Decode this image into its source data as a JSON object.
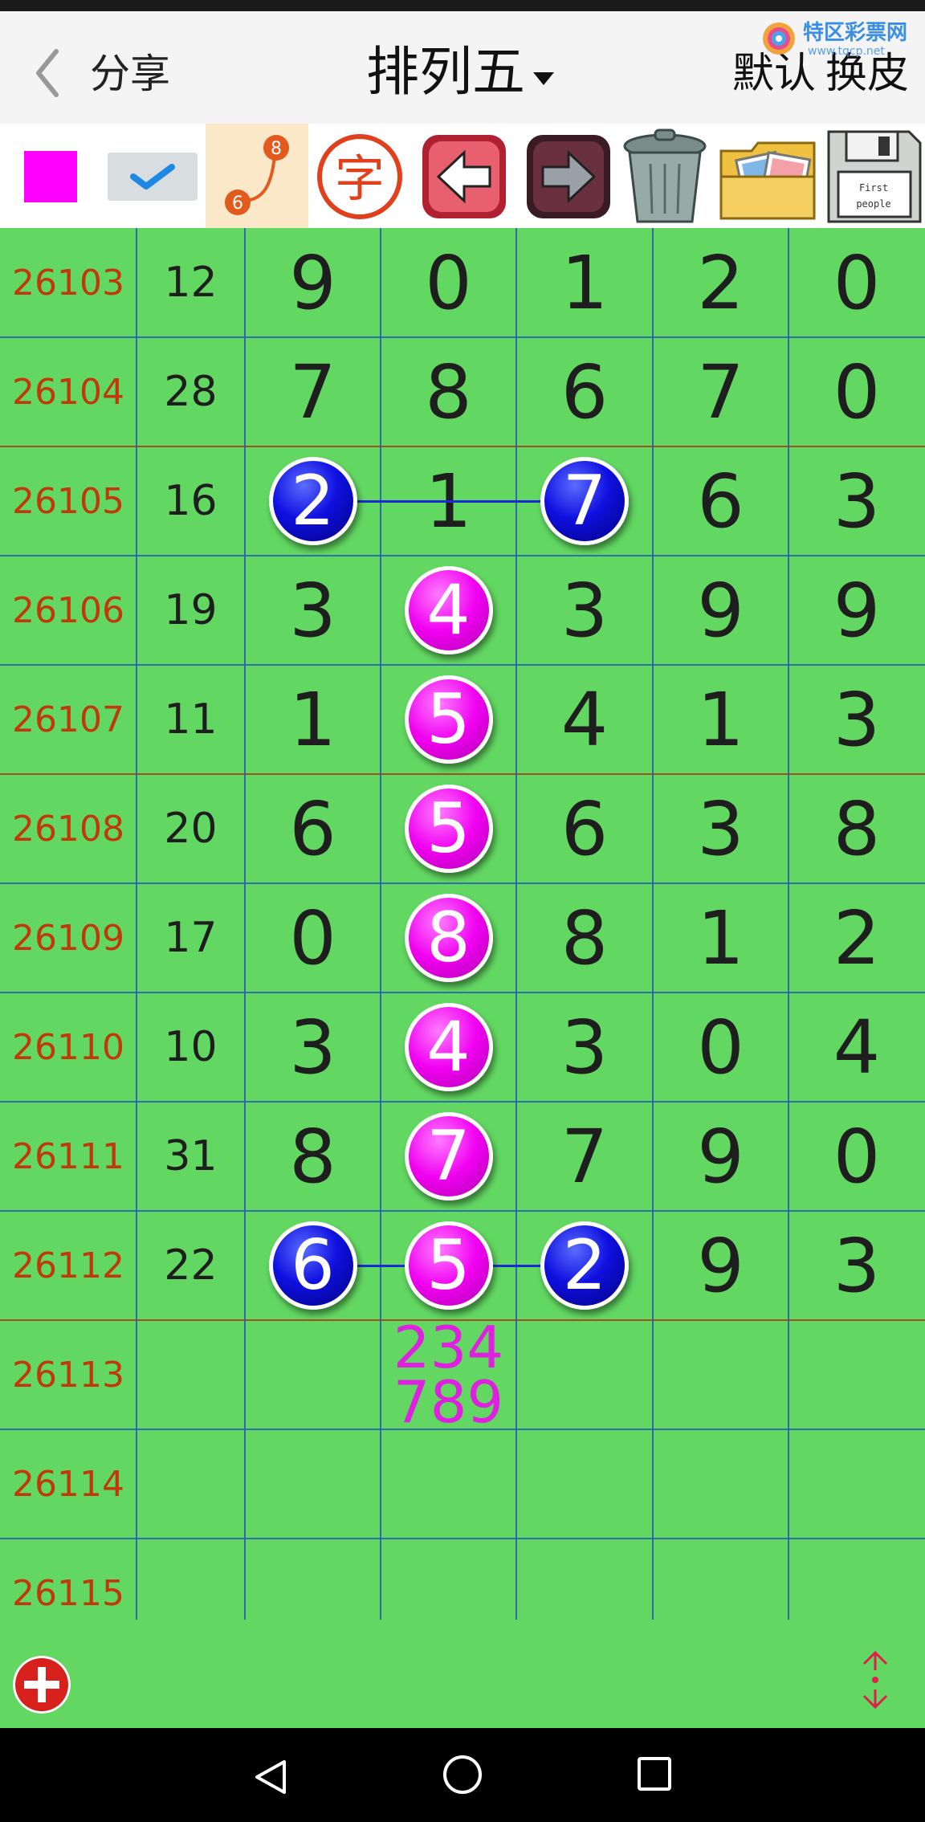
{
  "header": {
    "back_label": "‹",
    "share_label": "分享",
    "title": "排列五",
    "default_label": "默认",
    "skin_label": "换皮",
    "logo_text": "特区彩票网",
    "logo_url": "www.tqcp.net"
  },
  "toolbar": {
    "items": [
      {
        "name": "color-swatch",
        "color": "#ff00ff"
      },
      {
        "name": "check-toggle"
      },
      {
        "name": "line-connect-tool",
        "labels": [
          "8",
          "6"
        ]
      },
      {
        "name": "font-tool",
        "label": "字"
      },
      {
        "name": "undo-arrow"
      },
      {
        "name": "redo-arrow"
      },
      {
        "name": "trash"
      },
      {
        "name": "image-folder"
      },
      {
        "name": "save-disk",
        "labels": [
          "First",
          "people"
        ]
      }
    ]
  },
  "rows": [
    {
      "issue": "26103",
      "sum": "12",
      "digits": [
        "9",
        "0",
        "1",
        "2",
        "0"
      ]
    },
    {
      "issue": "26104",
      "sum": "28",
      "digits": [
        "7",
        "8",
        "6",
        "7",
        "0"
      ]
    },
    {
      "issue": "26105",
      "sum": "16",
      "digits": [
        "2",
        "1",
        "7",
        "6",
        "3"
      ]
    },
    {
      "issue": "26106",
      "sum": "19",
      "digits": [
        "3",
        "4",
        "3",
        "9",
        "9"
      ]
    },
    {
      "issue": "26107",
      "sum": "11",
      "digits": [
        "1",
        "5",
        "4",
        "1",
        "3"
      ]
    },
    {
      "issue": "26108",
      "sum": "20",
      "digits": [
        "6",
        "5",
        "6",
        "3",
        "8"
      ]
    },
    {
      "issue": "26109",
      "sum": "17",
      "digits": [
        "0",
        "8",
        "8",
        "1",
        "2"
      ]
    },
    {
      "issue": "26110",
      "sum": "10",
      "digits": [
        "3",
        "4",
        "3",
        "0",
        "4"
      ]
    },
    {
      "issue": "26111",
      "sum": "31",
      "digits": [
        "8",
        "7",
        "7",
        "9",
        "0"
      ]
    },
    {
      "issue": "26112",
      "sum": "22",
      "digits": [
        "6",
        "5",
        "2",
        "9",
        "3"
      ]
    },
    {
      "issue": "26113",
      "sum": "",
      "digits": [
        "",
        "",
        "",
        "",
        ""
      ]
    },
    {
      "issue": "26114",
      "sum": "",
      "digits": [
        "",
        "",
        "",
        "",
        ""
      ]
    },
    {
      "issue": "26115",
      "sum": "",
      "digits": [
        "",
        "",
        "",
        "",
        ""
      ]
    }
  ],
  "highlights": [
    {
      "row": 2,
      "col": 0,
      "style": "blue"
    },
    {
      "row": 2,
      "col": 2,
      "style": "blue"
    },
    {
      "row": 3,
      "col": 1,
      "style": "magenta"
    },
    {
      "row": 4,
      "col": 1,
      "style": "magenta"
    },
    {
      "row": 5,
      "col": 1,
      "style": "magenta"
    },
    {
      "row": 6,
      "col": 1,
      "style": "magenta"
    },
    {
      "row": 7,
      "col": 1,
      "style": "magenta"
    },
    {
      "row": 8,
      "col": 1,
      "style": "magenta"
    },
    {
      "row": 9,
      "col": 0,
      "style": "blue"
    },
    {
      "row": 9,
      "col": 1,
      "style": "magenta"
    },
    {
      "row": 9,
      "col": 2,
      "style": "blue"
    }
  ],
  "prediction": {
    "line1": "234",
    "line2": "789"
  },
  "colors": {
    "background": "#62d862",
    "issue": "#c0390a",
    "magenta": "#ff00ff",
    "blue": "#1010e0"
  }
}
